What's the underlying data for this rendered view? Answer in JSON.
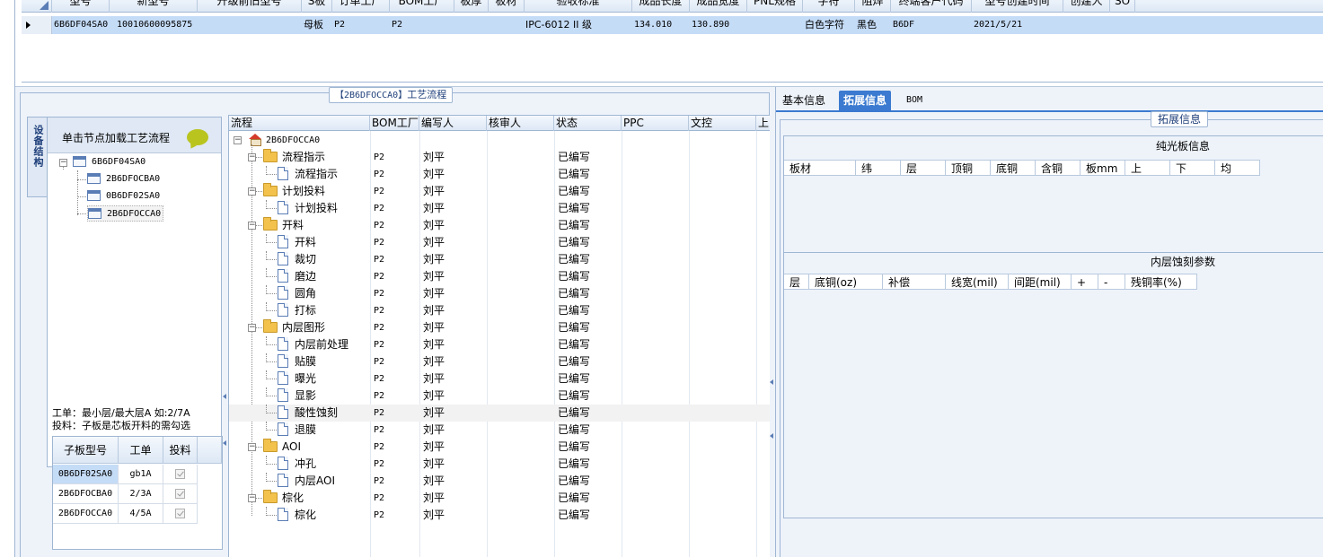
{
  "top_grid": {
    "columns": [
      "型号",
      "新型号",
      "升级前旧型号",
      "S板",
      "订单工厂",
      "BOM工厂",
      "板厚",
      "板材",
      "验收标准",
      "成品长度",
      "成品宽度",
      "PNL规格",
      "字符",
      "阻焊",
      "终端客户代码",
      "型号创建时间",
      "创建人",
      "SO"
    ],
    "row": {
      "model": "6B6DF04SA0",
      "new_model": "10010600095875",
      "old_model": "",
      "s_board": "母板",
      "order_factory": "P2",
      "bom_factory": "P2",
      "thickness": "",
      "material": "",
      "acceptance": "IPC-6012 II 级",
      "length": "134.010",
      "width": "130.890",
      "pnl": "",
      "legend": "白色字符",
      "solder": "黑色",
      "customer": "B6DF",
      "created": "2021/5/21",
      "creator": "",
      "so": ""
    }
  },
  "process_panel": {
    "legend_code": "【2B6DFOCCA0】",
    "legend_text": "工艺流程",
    "vertical_tab": "设备结构",
    "tree_title": "单击节点加载工艺流程",
    "tree": {
      "root": "6B6DF04SA0",
      "children": [
        "2B6DFOCBA0",
        "0B6DF02SA0",
        "2B6DFOCCA0"
      ]
    },
    "notes": [
      "工单：最小层/最大层A 如:2/7A",
      "投料：子板是芯板开料的需勾选"
    ],
    "sub_table": {
      "headers": [
        "子板型号",
        "工单",
        "投料"
      ],
      "rows": [
        {
          "model": "0B6DF02SA0",
          "order": "gb1A"
        },
        {
          "model": "2B6DFOCBA0",
          "order": "2/3A"
        },
        {
          "model": "2B6DFOCCA0",
          "order": "4/5A"
        }
      ]
    },
    "grid": {
      "headers": [
        "流程",
        "BOM工厂",
        "编写人",
        "核审人",
        "状态",
        "PPC",
        "文控",
        "上"
      ],
      "root": "2B6DFOCCA0",
      "rows": [
        {
          "name": "流程指示",
          "type": "folder",
          "factory": "P2",
          "writer": "刘平",
          "status": "已编写"
        },
        {
          "name": "流程指示",
          "type": "doc",
          "factory": "P2",
          "writer": "刘平",
          "status": "已编写"
        },
        {
          "name": "计划投料",
          "type": "folder",
          "factory": "P2",
          "writer": "刘平",
          "status": "已编写"
        },
        {
          "name": "计划投料",
          "type": "doc",
          "factory": "P2",
          "writer": "刘平",
          "status": "已编写"
        },
        {
          "name": "开料",
          "type": "folder",
          "factory": "P2",
          "writer": "刘平",
          "status": "已编写"
        },
        {
          "name": "开料",
          "type": "doc",
          "factory": "P2",
          "writer": "刘平",
          "status": "已编写"
        },
        {
          "name": "裁切",
          "type": "doc",
          "factory": "P2",
          "writer": "刘平",
          "status": "已编写"
        },
        {
          "name": "磨边",
          "type": "doc",
          "factory": "P2",
          "writer": "刘平",
          "status": "已编写"
        },
        {
          "name": "圆角",
          "type": "doc",
          "factory": "P2",
          "writer": "刘平",
          "status": "已编写"
        },
        {
          "name": "打标",
          "type": "doc",
          "factory": "P2",
          "writer": "刘平",
          "status": "已编写"
        },
        {
          "name": "内层图形",
          "type": "folder",
          "factory": "P2",
          "writer": "刘平",
          "status": "已编写"
        },
        {
          "name": "内层前处理",
          "type": "doc",
          "factory": "P2",
          "writer": "刘平",
          "status": "已编写"
        },
        {
          "name": "贴膜",
          "type": "doc",
          "factory": "P2",
          "writer": "刘平",
          "status": "已编写"
        },
        {
          "name": "曝光",
          "type": "doc",
          "factory": "P2",
          "writer": "刘平",
          "status": "已编写"
        },
        {
          "name": "显影",
          "type": "doc",
          "factory": "P2",
          "writer": "刘平",
          "status": "已编写"
        },
        {
          "name": "酸性蚀刻",
          "type": "doc",
          "factory": "P2",
          "writer": "刘平",
          "status": "已编写"
        },
        {
          "name": "退膜",
          "type": "doc",
          "factory": "P2",
          "writer": "刘平",
          "status": "已编写"
        },
        {
          "name": "AOI",
          "type": "folder",
          "factory": "P2",
          "writer": "刘平",
          "status": "已编写"
        },
        {
          "name": "冲孔",
          "type": "doc",
          "factory": "P2",
          "writer": "刘平",
          "status": "已编写"
        },
        {
          "name": "内层AOI",
          "type": "doc",
          "factory": "P2",
          "writer": "刘平",
          "status": "已编写"
        },
        {
          "name": "棕化",
          "type": "folder",
          "factory": "P2",
          "writer": "刘平",
          "status": "已编写"
        },
        {
          "name": "棕化",
          "type": "doc",
          "factory": "P2",
          "writer": "刘平",
          "status": "已编写"
        }
      ]
    }
  },
  "right_panel": {
    "tabs": [
      "基本信息",
      "拓展信息",
      "BOM"
    ],
    "active_tab": "拓展信息",
    "legend": "拓展信息",
    "section1_title": "纯光板信息",
    "section1_headers": [
      "板材",
      "纬",
      "层",
      "顶铜",
      "底铜",
      "含铜",
      "板mm",
      "上",
      "下",
      "均"
    ],
    "section2_title": "内层蚀刻参数",
    "section2_headers": [
      "层",
      "底铜(oz)",
      "补偿",
      "线宽(mil)",
      "间距(mil)",
      "+",
      "-",
      "残铜率(%)"
    ]
  },
  "colors": {
    "selected_row": "#c5dcf7",
    "active_tab": "#3b7ad0",
    "panel_bg": "#eef3fa"
  }
}
